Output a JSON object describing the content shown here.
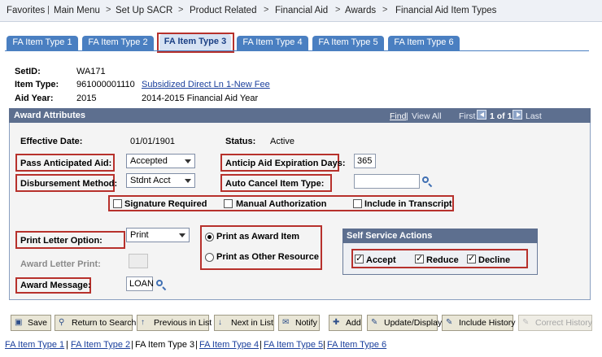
{
  "breadcrumb": [
    "Favorites",
    "Main Menu",
    "Set Up SACR",
    "Product Related",
    "Financial Aid",
    "Awards",
    "Financial Aid Item Types"
  ],
  "tabs": [
    "FA Item Type 1",
    "FA Item Type 2",
    "FA Item Type 3",
    "FA Item Type 4",
    "FA Item Type 5",
    "FA Item Type 6"
  ],
  "active_tab": "FA Item Type 3",
  "header": {
    "setid_label": "SetID:",
    "setid_value": "WA171",
    "item_type_label": "Item Type:",
    "item_type_value": "961000001110",
    "item_type_desc": "Subsidized Direct Ln 1-New Fee",
    "aid_year_label": "Aid Year:",
    "aid_year_value": "2015",
    "aid_year_desc": "2014-2015 Financial Aid Year"
  },
  "award": {
    "title": "Award Attributes",
    "nav_find": "Find",
    "nav_viewall": "View All",
    "nav_first": "First",
    "nav_count": "1 of 1",
    "nav_last": "Last",
    "effective_date_label": "Effective Date:",
    "effective_date_value": "01/01/1901",
    "status_label": "Status:",
    "status_value": "Active",
    "pass_anticipated_label": "Pass Anticipated Aid:",
    "pass_anticipated_value": "Accepted",
    "anticip_exp_label": "Anticip Aid Expiration Days:",
    "anticip_exp_value": "365",
    "disb_method_label": "Disbursement Method:",
    "disb_method_value": "Stdnt Acct",
    "auto_cancel_label": "Auto Cancel Item Type:",
    "auto_cancel_value": "",
    "signature_label": "Signature Required",
    "signature_checked": false,
    "manual_auth_label": "Manual Authorization",
    "manual_auth_checked": false,
    "transcript_label": "Include in Transcript",
    "transcript_checked": false,
    "print_letter_label": "Print Letter Option:",
    "print_letter_value": "Print",
    "award_letter_print_label": "Award Letter Print:",
    "award_letter_print_value": "",
    "award_message_label": "Award Message:",
    "award_message_value": "LOAN",
    "print_award_item_label": "Print as Award Item",
    "print_award_item_selected": true,
    "print_other_label": "Print as Other Resource",
    "print_other_selected": false,
    "self_service_title": "Self Service Actions",
    "accept_label": "Accept",
    "accept_checked": true,
    "reduce_label": "Reduce",
    "reduce_checked": true,
    "decline_label": "Decline",
    "decline_checked": true
  },
  "toolbar": [
    "Save",
    "Return to Search",
    "Previous in List",
    "Next in List",
    "Notify",
    "Add",
    "Update/Display",
    "Include History",
    "Correct History"
  ],
  "footer_links": [
    "FA Item Type 1",
    "FA Item Type 2",
    "FA Item Type 3",
    "FA Item Type 4",
    "FA Item Type 5",
    "FA Item Type 6"
  ],
  "colors": {
    "highlight": "#b7312c",
    "tab": "#4a7fc1",
    "panel_header": "#5d6f8f",
    "link": "#1a3f9c"
  }
}
